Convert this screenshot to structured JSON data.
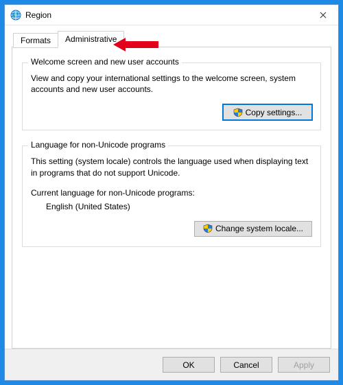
{
  "window": {
    "title": "Region"
  },
  "tabs": {
    "formats": "Formats",
    "administrative": "Administrative"
  },
  "group_welcome": {
    "legend": "Welcome screen and new user accounts",
    "text": "View and copy your international settings to the welcome screen, system accounts and new user accounts.",
    "copy_button": "Copy settings..."
  },
  "group_locale": {
    "legend": "Language for non-Unicode programs",
    "text": "This setting (system locale) controls the language used when displaying text in programs that do not support Unicode.",
    "current_label": "Current language for non-Unicode programs:",
    "current_value": "English (United States)",
    "change_button": "Change system locale..."
  },
  "footer": {
    "ok": "OK",
    "cancel": "Cancel",
    "apply": "Apply"
  },
  "icons": {
    "globe": "globe-icon",
    "shield": "uac-shield-icon",
    "close": "close-icon"
  }
}
